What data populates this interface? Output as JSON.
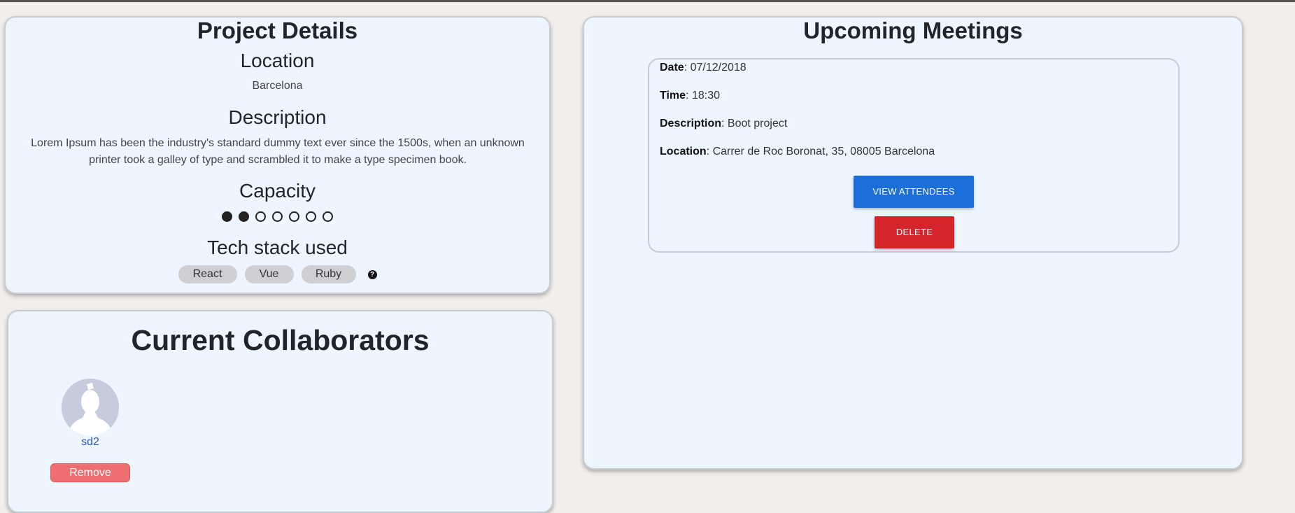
{
  "project": {
    "title": "Project Details",
    "location_heading": "Location",
    "location": "Barcelona",
    "description_heading": "Description",
    "description": "Lorem Ipsum has been the industry's standard dummy text ever since the 1500s, when an unknown printer took a galley of type and scrambled it to make a type specimen book.",
    "capacity_heading": "Capacity",
    "capacity": {
      "filled": 2,
      "total": 7
    },
    "tech_heading": "Tech stack used",
    "tech": [
      "React",
      "Vue",
      "Ruby"
    ],
    "help_icon": "question-circle-icon"
  },
  "collaborators": {
    "title": "Current Collaborators",
    "items": [
      {
        "name": "sd2",
        "remove_label": "Remove"
      }
    ]
  },
  "meetings": {
    "title": "Upcoming Meetings",
    "items": [
      {
        "date_label": "Date",
        "date": "07/12/2018",
        "time_label": "Time",
        "time": "18:30",
        "description_label": "Description",
        "description": "Boot project",
        "location_label": "Location",
        "location": "Carrer de Roc Boronat, 35, 08005 Barcelona",
        "view_label": "VIEW ATTENDEES",
        "delete_label": "DELETE"
      }
    ]
  },
  "colors": {
    "panel_bg": "#edf5ff",
    "primary": "#1c6fd8",
    "danger": "#d3252b",
    "remove": "#ef6f71",
    "link": "#2d55c7"
  }
}
